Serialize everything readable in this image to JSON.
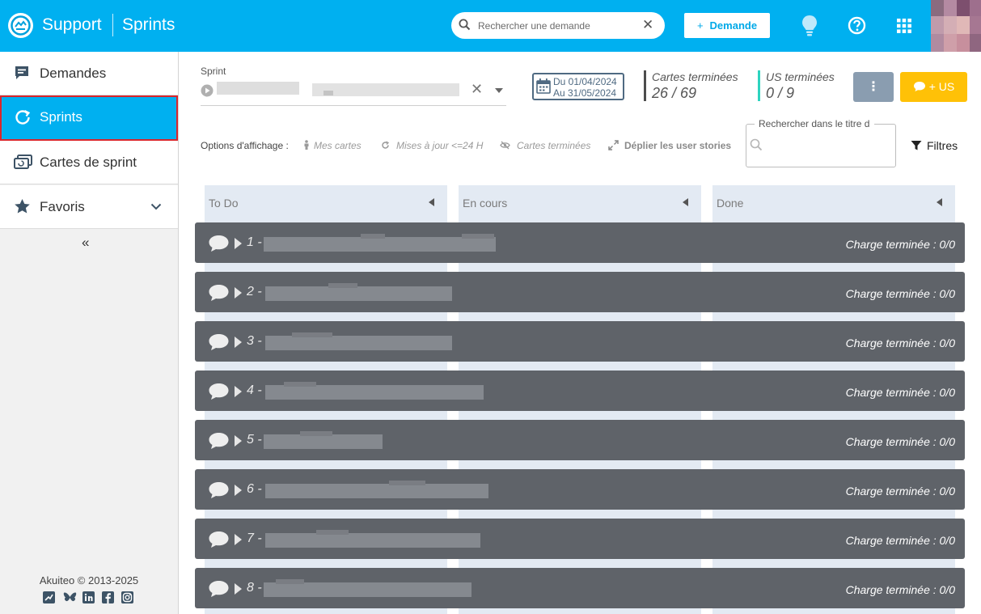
{
  "header": {
    "app_name": "Support",
    "module_name": "Sprints",
    "search_placeholder": "Rechercher une demande",
    "search_clear": "✕",
    "new_request_plus": "+",
    "new_request_label": "Demande",
    "accent_color": "#00b0f0",
    "icons": [
      "logo-icon",
      "search-icon",
      "lightbulb-icon",
      "help-icon",
      "apps-grid-icon",
      "avatar"
    ]
  },
  "sidebar": {
    "items": [
      {
        "label": "Demandes",
        "icon": "comment-icon"
      },
      {
        "label": "Sprints",
        "icon": "sprint-cycle-icon",
        "active": true
      },
      {
        "label": "Cartes de sprint",
        "icon": "cards-icon"
      },
      {
        "label": "Favoris",
        "icon": "star-icon"
      }
    ],
    "collapse_glyph": "«",
    "copyright": "Akuiteo © 2013-2025",
    "socials": [
      "stats-icon",
      "bluesky-icon",
      "linkedin-icon",
      "facebook-icon",
      "instagram-icon"
    ]
  },
  "sprint": {
    "label": "Sprint",
    "clear_glyph": "✕",
    "date_from": "Du 01/04/2024",
    "date_to": "Au 31/05/2024"
  },
  "stats": {
    "cards_done_label": "Cartes terminées",
    "cards_done_value": "26 / 69",
    "us_done_label": "US terminées",
    "us_done_value": "0 / 9"
  },
  "actions": {
    "more_label": "⋮",
    "add_us_label": "+ US"
  },
  "display_options": {
    "label": "Options d'affichage :",
    "my_cards": "Mes cartes",
    "updated": "Mises à jour <=24 H",
    "done_cards": "Cartes terminées",
    "expand_stories": "Déplier les user stories"
  },
  "title_search": {
    "legend": "Rechercher dans le titre d"
  },
  "filters_label": "Filtres",
  "columns": [
    "To Do",
    "En cours",
    "Done"
  ],
  "stories": [
    {
      "number": "1 -",
      "charge": "Charge terminée : 0/0"
    },
    {
      "number": "2 -",
      "charge": "Charge terminée : 0/0"
    },
    {
      "number": "3 -",
      "charge": "Charge terminée : 0/0"
    },
    {
      "number": "4 -",
      "charge": "Charge terminée : 0/0"
    },
    {
      "number": "5 -",
      "charge": "Charge terminée : 0/0"
    },
    {
      "number": "6 -",
      "charge": "Charge terminée : 0/0"
    },
    {
      "number": "7 -",
      "charge": "Charge terminée : 0/0"
    },
    {
      "number": "8 -",
      "charge": "Charge terminée : 0/0"
    }
  ]
}
